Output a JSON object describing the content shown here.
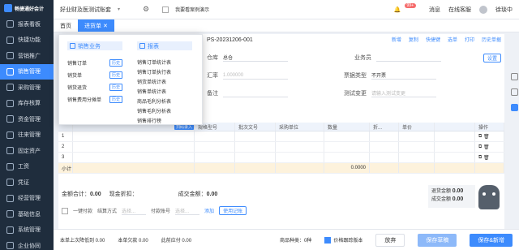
{
  "sidebar": {
    "logo": "畅捷通好会计",
    "items": [
      {
        "label": "报表看板"
      },
      {
        "label": "快捷功能"
      },
      {
        "label": "营销推广"
      },
      {
        "label": "销售管理",
        "active": true
      },
      {
        "label": "采购管理"
      },
      {
        "label": "库存核算"
      },
      {
        "label": "资金管理"
      },
      {
        "label": "往来管理"
      },
      {
        "label": "固定资产"
      },
      {
        "label": "工资"
      },
      {
        "label": "凭证"
      },
      {
        "label": "经营管理"
      },
      {
        "label": "基础信息"
      },
      {
        "label": "系统管理"
      },
      {
        "label": "企业协同"
      }
    ]
  },
  "topbar": {
    "company": "好业财及医测试账套",
    "demo_label": "我要看案例演示",
    "notification_count": "99+",
    "message_label": "消息",
    "service_label": "在线客服",
    "user_name": "徐琰中"
  },
  "tabs": [
    {
      "label": "首页",
      "active": false
    },
    {
      "label": "进货单",
      "active": true
    }
  ],
  "toolbar": {
    "doc_no": "PS-20231206-001",
    "buttons": [
      "新增",
      "复制",
      "快捷键",
      "选单",
      "打印",
      "历史单据"
    ]
  },
  "form": {
    "warehouse_label": "仓库",
    "warehouse_value": "总仓",
    "salesperson_label": "业务员",
    "rate_label": "汇率",
    "rate_value": "1.000000",
    "invoice_type_label": "票据类型",
    "invoice_type_value": "不开票",
    "note_label": "备注",
    "test_label": "测试变更",
    "test_placeholder": "请输入测试变更",
    "settings_label": "设置"
  },
  "grid": {
    "scan_label": "扫码录入",
    "headers": [
      "",
      "",
      "规格型号",
      "批次文号",
      "采购单位",
      "数量",
      "折...",
      "单价",
      "",
      "操作"
    ],
    "rows": [
      "1",
      "2",
      "3"
    ],
    "subtotal_label": "小计",
    "subtotal_qty": "0.0000"
  },
  "totals": {
    "amount_label": "金额合计：",
    "amount_value": "0.00",
    "discount_label": "现金折扣：",
    "deal_label": "成交金额：",
    "deal_value": "0.00"
  },
  "payment": {
    "label": "一键付款",
    "method_label": "结算方式",
    "method_placeholder": "选择...",
    "account_label": "付款账号",
    "account_placeholder": "选择...",
    "add_label": "添加",
    "common_label": "使用记账"
  },
  "summary": {
    "return_label": "退货金额",
    "return_value": "0.00",
    "deal_label": "成交金额",
    "deal_value": "0.00"
  },
  "footer": {
    "item1": "本单上次降低到 0.00",
    "item2": "本单欠款 0.00",
    "item3": "此前应付 0.00",
    "goods_kind_label": "商品种类：",
    "goods_kind_value": "0种",
    "price_check_label": "价格跟踪版本",
    "abandon_label": "放弃",
    "draft_label": "保存草稿",
    "save_new_label": "保存&新增"
  },
  "dropdown": {
    "col1_title": "销售业务",
    "col2_title": "报表",
    "history_label": "历史",
    "col1_items": [
      "销售订单",
      "销货单",
      "销货退货",
      "销售费用分摊单"
    ],
    "col2_items": [
      "销售订单统计表",
      "销售订单执行表",
      "销货单统计表",
      "销售单统计表",
      "商品毛利分析表",
      "销售毛利分析表",
      "销售排行榜"
    ]
  },
  "colors": {
    "accent": "#3d8bfd",
    "sidebar_bg": "#1f2d3d"
  }
}
